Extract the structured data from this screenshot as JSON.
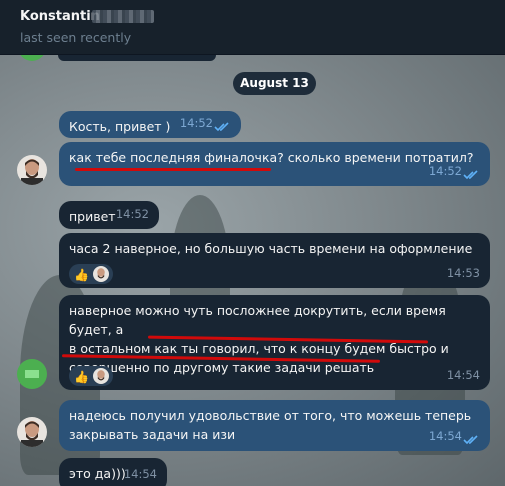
{
  "header": {
    "name": "Konstantin",
    "status": "last seen recently"
  },
  "chat": {
    "date": "August 13",
    "messages": [
      {
        "text": "Кость, привет )",
        "time": "14:52",
        "outgoing": true
      },
      {
        "text": "как тебе последняя финалочка? сколько времени потратил?",
        "time": "14:52",
        "outgoing": true
      },
      {
        "text": "привет",
        "time": "14:52",
        "outgoing": false
      },
      {
        "text": "часа 2 наверное, но большую часть времени на оформление",
        "time": "14:53",
        "outgoing": false,
        "reaction": "👍"
      },
      {
        "lines": [
          "наверное можно чуть посложнее докрутить, если время будет, а",
          "в остальном как ты говорил, что к концу будем быстро и",
          "совершенно по другому такие задачи решать"
        ],
        "time": "14:54",
        "outgoing": false,
        "reaction": "👍"
      },
      {
        "lines": [
          "надеюсь получил удовольствие от того, что можешь теперь",
          "закрывать задачи на изи"
        ],
        "time": "14:54",
        "outgoing": true
      },
      {
        "text": "это да)))",
        "time": "14:54",
        "outgoing": false
      }
    ]
  },
  "colors": {
    "incoming_bubble": "#182533",
    "outgoing_bubble": "#2b5278",
    "highlight_underline": "#d10a0a",
    "contact_avatar": "#4caf50"
  }
}
